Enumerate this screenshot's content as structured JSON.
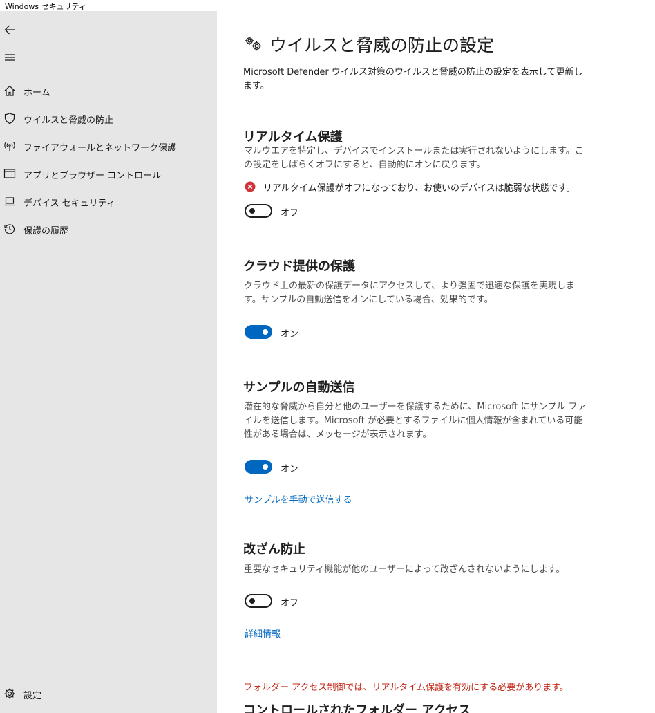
{
  "window": {
    "title": "Windows セキュリティ"
  },
  "sidebar": {
    "back_icon": "back-arrow-icon",
    "menu_icon": "hamburger-menu-icon",
    "items": [
      {
        "label": "ホーム",
        "icon": "home-icon"
      },
      {
        "label": "ウイルスと脅威の防止",
        "icon": "shield-icon"
      },
      {
        "label": "ファイアウォールとネットワーク保護",
        "icon": "wireless-antenna-icon"
      },
      {
        "label": "アプリとブラウザー コントロール",
        "icon": "app-window-icon"
      },
      {
        "label": "デバイス セキュリティ",
        "icon": "laptop-icon"
      },
      {
        "label": "保護の履歴",
        "icon": "history-icon"
      }
    ],
    "settings": {
      "label": "設定",
      "icon": "gear-icon"
    }
  },
  "main": {
    "title": "ウイルスと脅威の防止の設定",
    "title_icon": "gears-icon",
    "description": "Microsoft Defender ウイルス対策のウイルスと脅威の防止の設定を表示して更新します。",
    "realtime": {
      "title": "リアルタイム保護",
      "description": "マルウエアを特定し、デバイスでインストールまたは実行されないようにします。この設定をしばらくオフにすると、自動的にオンに戻ります。",
      "warning": "リアルタイム保護がオフになっており、お使いのデバイスは脆弱な状態です。",
      "warning_icon": "error-circle-icon",
      "toggle_label": "オフ",
      "enabled": false
    },
    "cloud": {
      "title": "クラウド提供の保護",
      "description": "クラウド上の最新の保護データにアクセスして、より強固で迅速な保護を実現します。サンプルの自動送信をオンにしている場合、効果的です。",
      "toggle_label": "オン",
      "enabled": true
    },
    "sample": {
      "title": "サンプルの自動送信",
      "description": "潜在的な脅威から自分と他のユーザーを保護するために、Microsoft にサンプル ファイルを送信します。Microsoft が必要とするファイルに個人情報が含まれている可能性がある場合は、メッセージが表示されます。",
      "toggle_label": "オン",
      "enabled": true,
      "link": "サンプルを手動で送信する"
    },
    "tamper": {
      "title": "改ざん防止",
      "description": "重要なセキュリティ機能が他のユーザーによって改ざんされないようにします。",
      "toggle_label": "オフ",
      "enabled": false,
      "link": "詳細情報"
    },
    "folder": {
      "note": "フォルダー アクセス制御では、リアルタイム保護を有効にする必要があります。",
      "title": "コントロールされたフォルダー アクセス"
    }
  },
  "colors": {
    "accent": "#0067c0",
    "error": "#c42b1c",
    "sidebar_bg": "#e6e6e6"
  }
}
